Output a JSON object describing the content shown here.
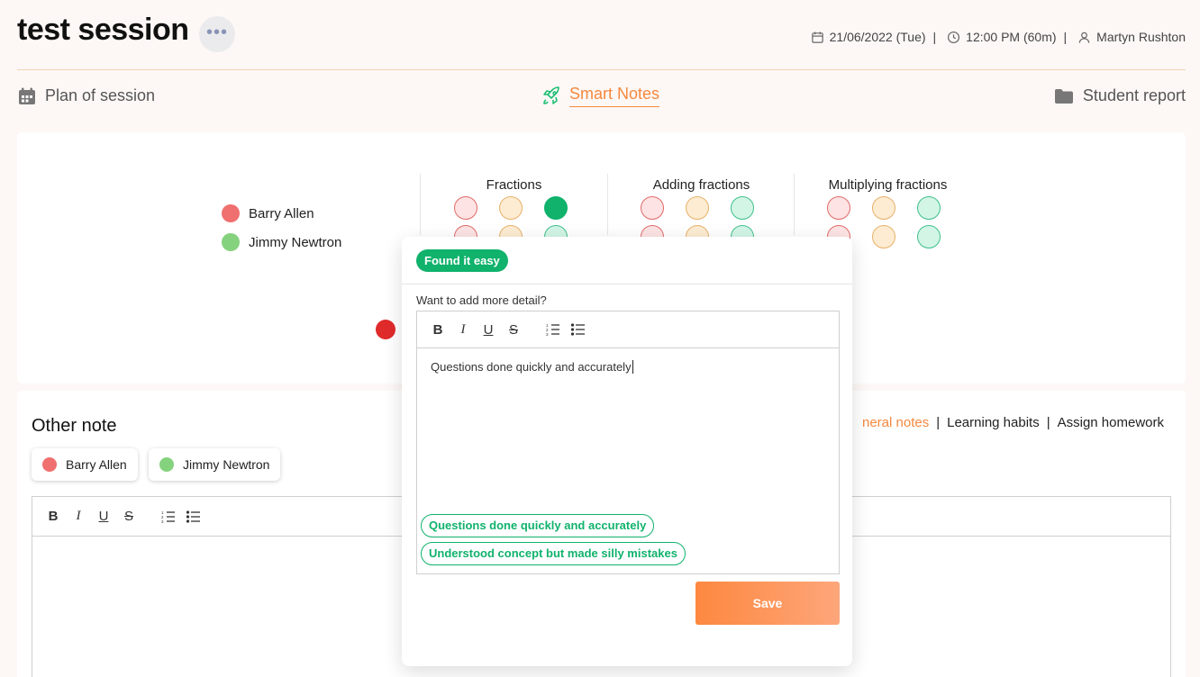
{
  "header": {
    "title": "test session",
    "more_icon": "more-horizontal-icon",
    "date": "21/06/2022 (Tue)",
    "time": "12:00 PM (60m)",
    "tutor": "Martyn Rushton",
    "separator": "|"
  },
  "nav": {
    "plan": "Plan of session",
    "smart_notes": "Smart Notes",
    "student_report": "Student report",
    "accent_color": "#f5883e"
  },
  "overview": {
    "students": [
      {
        "name": "Barry Allen",
        "color": "#f06f6f"
      },
      {
        "name": "Jimmy Newtron",
        "color": "#85d27e"
      }
    ],
    "topics": [
      "Fractions",
      "Adding fractions",
      "Multiplying fractions"
    ]
  },
  "other_note": {
    "title": "Other note",
    "tabs": [
      {
        "label": "General notes",
        "visible_text": "neral notes",
        "active": true
      },
      {
        "label": "Learning habits",
        "active": false
      },
      {
        "label": "Assign homework",
        "active": false
      }
    ],
    "chips": [
      "Barry Allen",
      "Jimmy Newtron"
    ]
  },
  "popup": {
    "tag": "Found it easy",
    "prompt": "Want to add more detail?",
    "content": "Questions done quickly and accurately",
    "suggestions": [
      "Questions done quickly and accurately",
      "Understood concept but made silly mistakes"
    ],
    "save_label": "Save"
  },
  "colors": {
    "green": "#10b26c",
    "red": "#e16a6a",
    "orange": "#e8b06a"
  }
}
